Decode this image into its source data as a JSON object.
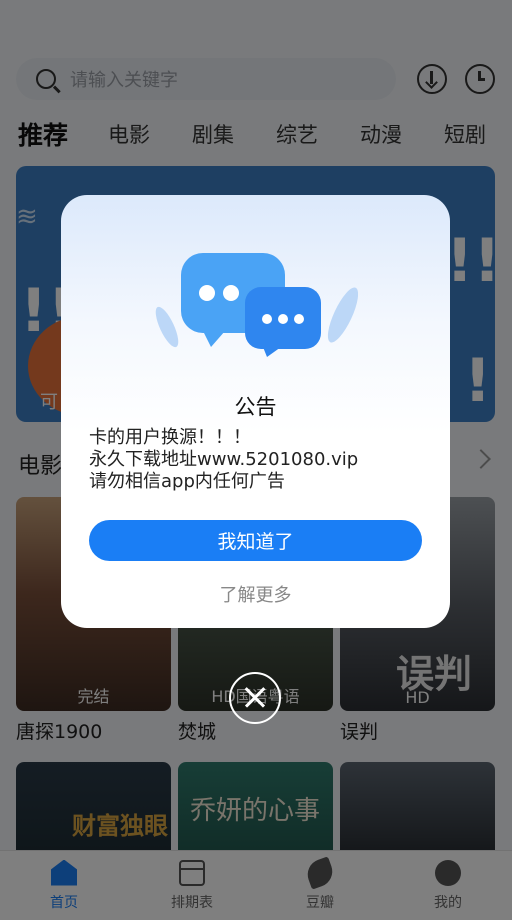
{
  "search": {
    "placeholder": "请输入关键字"
  },
  "header_icons": {
    "download": "download-icon",
    "history": "history-icon"
  },
  "tabs": [
    {
      "label": "推荐"
    },
    {
      "label": "电影"
    },
    {
      "label": "剧集"
    },
    {
      "label": "综艺"
    },
    {
      "label": "动漫"
    },
    {
      "label": "短剧"
    }
  ],
  "banner": {
    "text": "可"
  },
  "section": {
    "title": "电影"
  },
  "posters": [
    {
      "title": "唐探1900",
      "badge": "完结"
    },
    {
      "title": "焚城",
      "badge": "HD国语粤语"
    },
    {
      "title": "误判",
      "badge": "HD",
      "poster_text": "误判"
    },
    {
      "poster_text": "财富独眼"
    },
    {
      "poster_text": "乔妍的心事"
    },
    {
      "poster_text": ""
    }
  ],
  "bottom_nav": [
    {
      "label": "首页",
      "active": true
    },
    {
      "label": "排期表"
    },
    {
      "label": "豆瓣"
    },
    {
      "label": "我的"
    }
  ],
  "dialog": {
    "title": "公告",
    "lines": [
      "卡的用户换源！！！",
      "永久下载地址www.5201080.vip",
      "请勿相信app内任何广告"
    ],
    "confirm_label": "我知道了",
    "more_label": "了解更多"
  },
  "colors": {
    "accent": "#1a7ef5",
    "overlay": "rgba(0,0,0,0.5)"
  }
}
